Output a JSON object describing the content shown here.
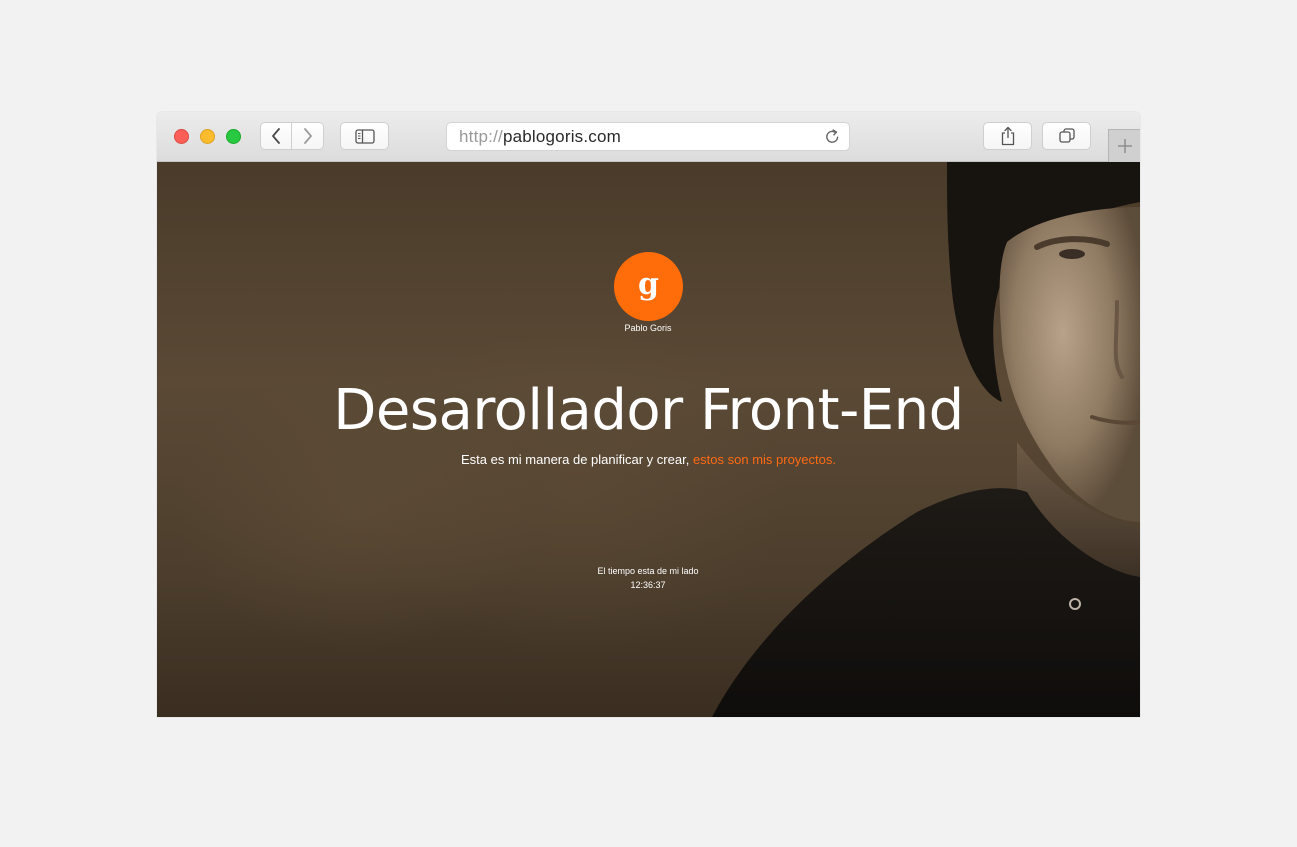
{
  "browser": {
    "url_protocol": "http://",
    "url_host": "pablogoris.com",
    "icons": {
      "close": "close-dot",
      "minimize": "minimize-dot",
      "zoom": "zoom-dot",
      "back": "chevron-left-icon",
      "forward": "chevron-right-icon",
      "sidebar": "sidebar-icon",
      "reload": "reload-icon",
      "share": "share-icon",
      "tabs": "tabs-icon",
      "new_tab": "plus-icon"
    }
  },
  "site": {
    "logo_letter": "g",
    "logo_name": "Pablo Goris",
    "headline": "Desarollador Front-End",
    "tagline_text": "Esta es mi manera de planificar y crear,",
    "tagline_link": "estos son mis proyectos.",
    "time_label": "El tiempo esta de mi lado",
    "time_value": "12:36:37"
  },
  "colors": {
    "accent": "#ff6c0a",
    "background": "#f2f2f2",
    "page_tint": "#4a3b2a"
  }
}
